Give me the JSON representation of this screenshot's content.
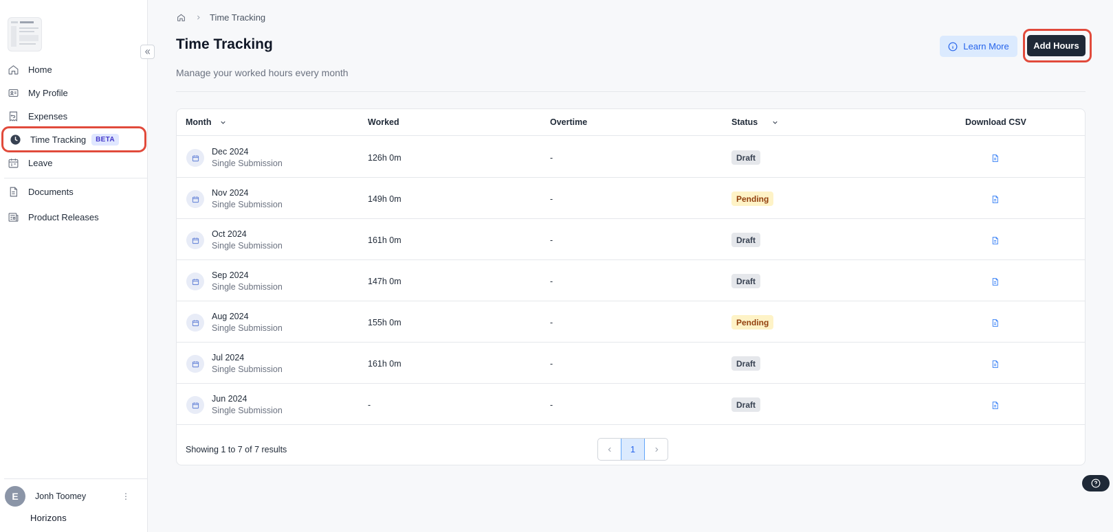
{
  "sidebar": {
    "nav": [
      {
        "label": "Home",
        "icon": "home-icon"
      },
      {
        "label": "My Profile",
        "icon": "id-card-icon"
      },
      {
        "label": "Expenses",
        "icon": "receipt-icon"
      },
      {
        "label": "Time Tracking",
        "icon": "clock-icon",
        "badge": "BETA",
        "active": true
      },
      {
        "label": "Leave",
        "icon": "calendar-icon"
      },
      {
        "label": "Documents",
        "icon": "document-icon"
      },
      {
        "label": "Product Releases",
        "icon": "newspaper-icon"
      }
    ],
    "user": {
      "initial": "E",
      "name": "Jonh Toomey"
    },
    "brand": "Horizons"
  },
  "breadcrumb": {
    "current": "Time Tracking"
  },
  "header": {
    "title": "Time Tracking",
    "subtitle": "Manage your worked hours every month",
    "learn_more": "Learn More",
    "add_hours": "Add Hours"
  },
  "table": {
    "columns": {
      "month": "Month",
      "worked": "Worked",
      "overtime": "Overtime",
      "status": "Status",
      "download": "Download CSV"
    },
    "rows": [
      {
        "month": "Dec 2024",
        "type": "Single Submission",
        "worked": "126h 0m",
        "overtime": "-",
        "status": "Draft"
      },
      {
        "month": "Nov 2024",
        "type": "Single Submission",
        "worked": "149h 0m",
        "overtime": "-",
        "status": "Pending"
      },
      {
        "month": "Oct 2024",
        "type": "Single Submission",
        "worked": "161h 0m",
        "overtime": "-",
        "status": "Draft"
      },
      {
        "month": "Sep 2024",
        "type": "Single Submission",
        "worked": "147h 0m",
        "overtime": "-",
        "status": "Draft"
      },
      {
        "month": "Aug 2024",
        "type": "Single Submission",
        "worked": "155h 0m",
        "overtime": "-",
        "status": "Pending"
      },
      {
        "month": "Jul 2024",
        "type": "Single Submission",
        "worked": "161h 0m",
        "overtime": "-",
        "status": "Draft"
      },
      {
        "month": "Jun 2024",
        "type": "Single Submission",
        "worked": "-",
        "overtime": "-",
        "status": "Draft"
      }
    ],
    "footer": "Showing 1 to 7 of 7 results",
    "page": "1"
  },
  "colors": {
    "accent": "#2563eb",
    "highlight": "#e14a3b",
    "dark": "#1f2937"
  }
}
